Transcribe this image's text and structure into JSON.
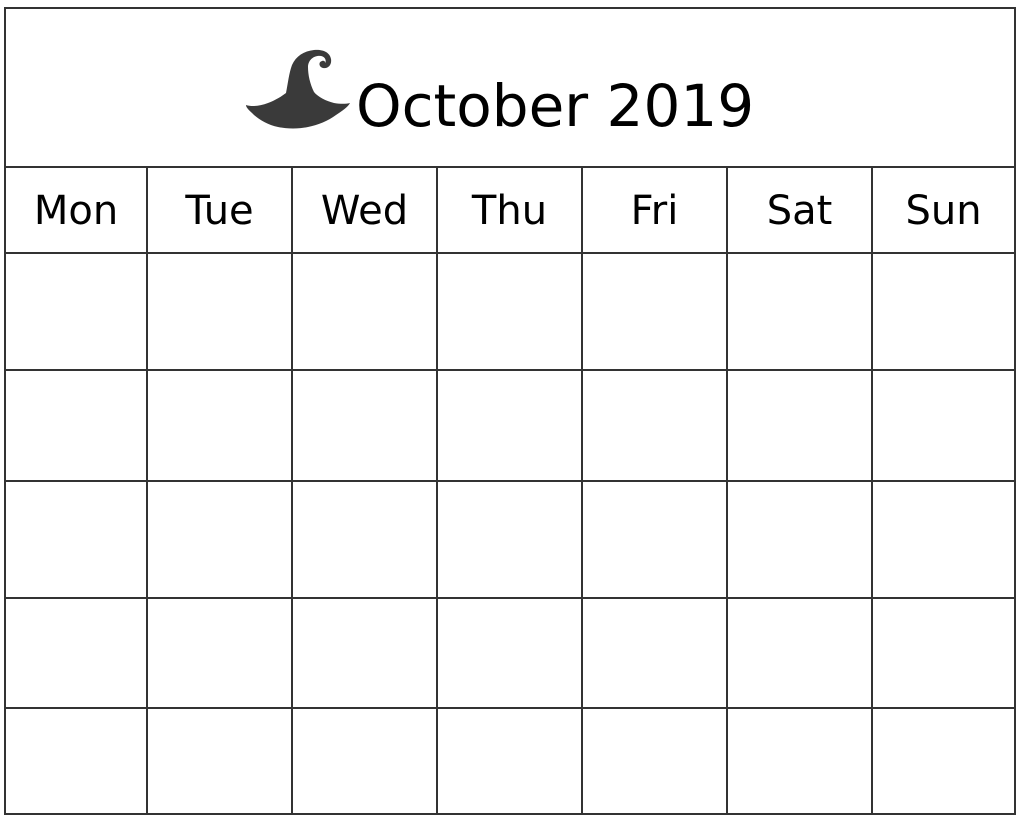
{
  "calendar": {
    "title": "October 2019",
    "decoration_icon": "witch-hat-icon",
    "hat_color": "#3a3a3a",
    "weekdays": [
      "Mon",
      "Tue",
      "Wed",
      "Thu",
      "Fri",
      "Sat",
      "Sun"
    ],
    "weeks": [
      [
        "",
        "",
        "",
        "",
        "",
        "",
        ""
      ],
      [
        "",
        "",
        "",
        "",
        "",
        "",
        ""
      ],
      [
        "",
        "",
        "",
        "",
        "",
        "",
        ""
      ],
      [
        "",
        "",
        "",
        "",
        "",
        "",
        ""
      ],
      [
        "",
        "",
        "",
        "",
        "",
        "",
        ""
      ]
    ]
  }
}
